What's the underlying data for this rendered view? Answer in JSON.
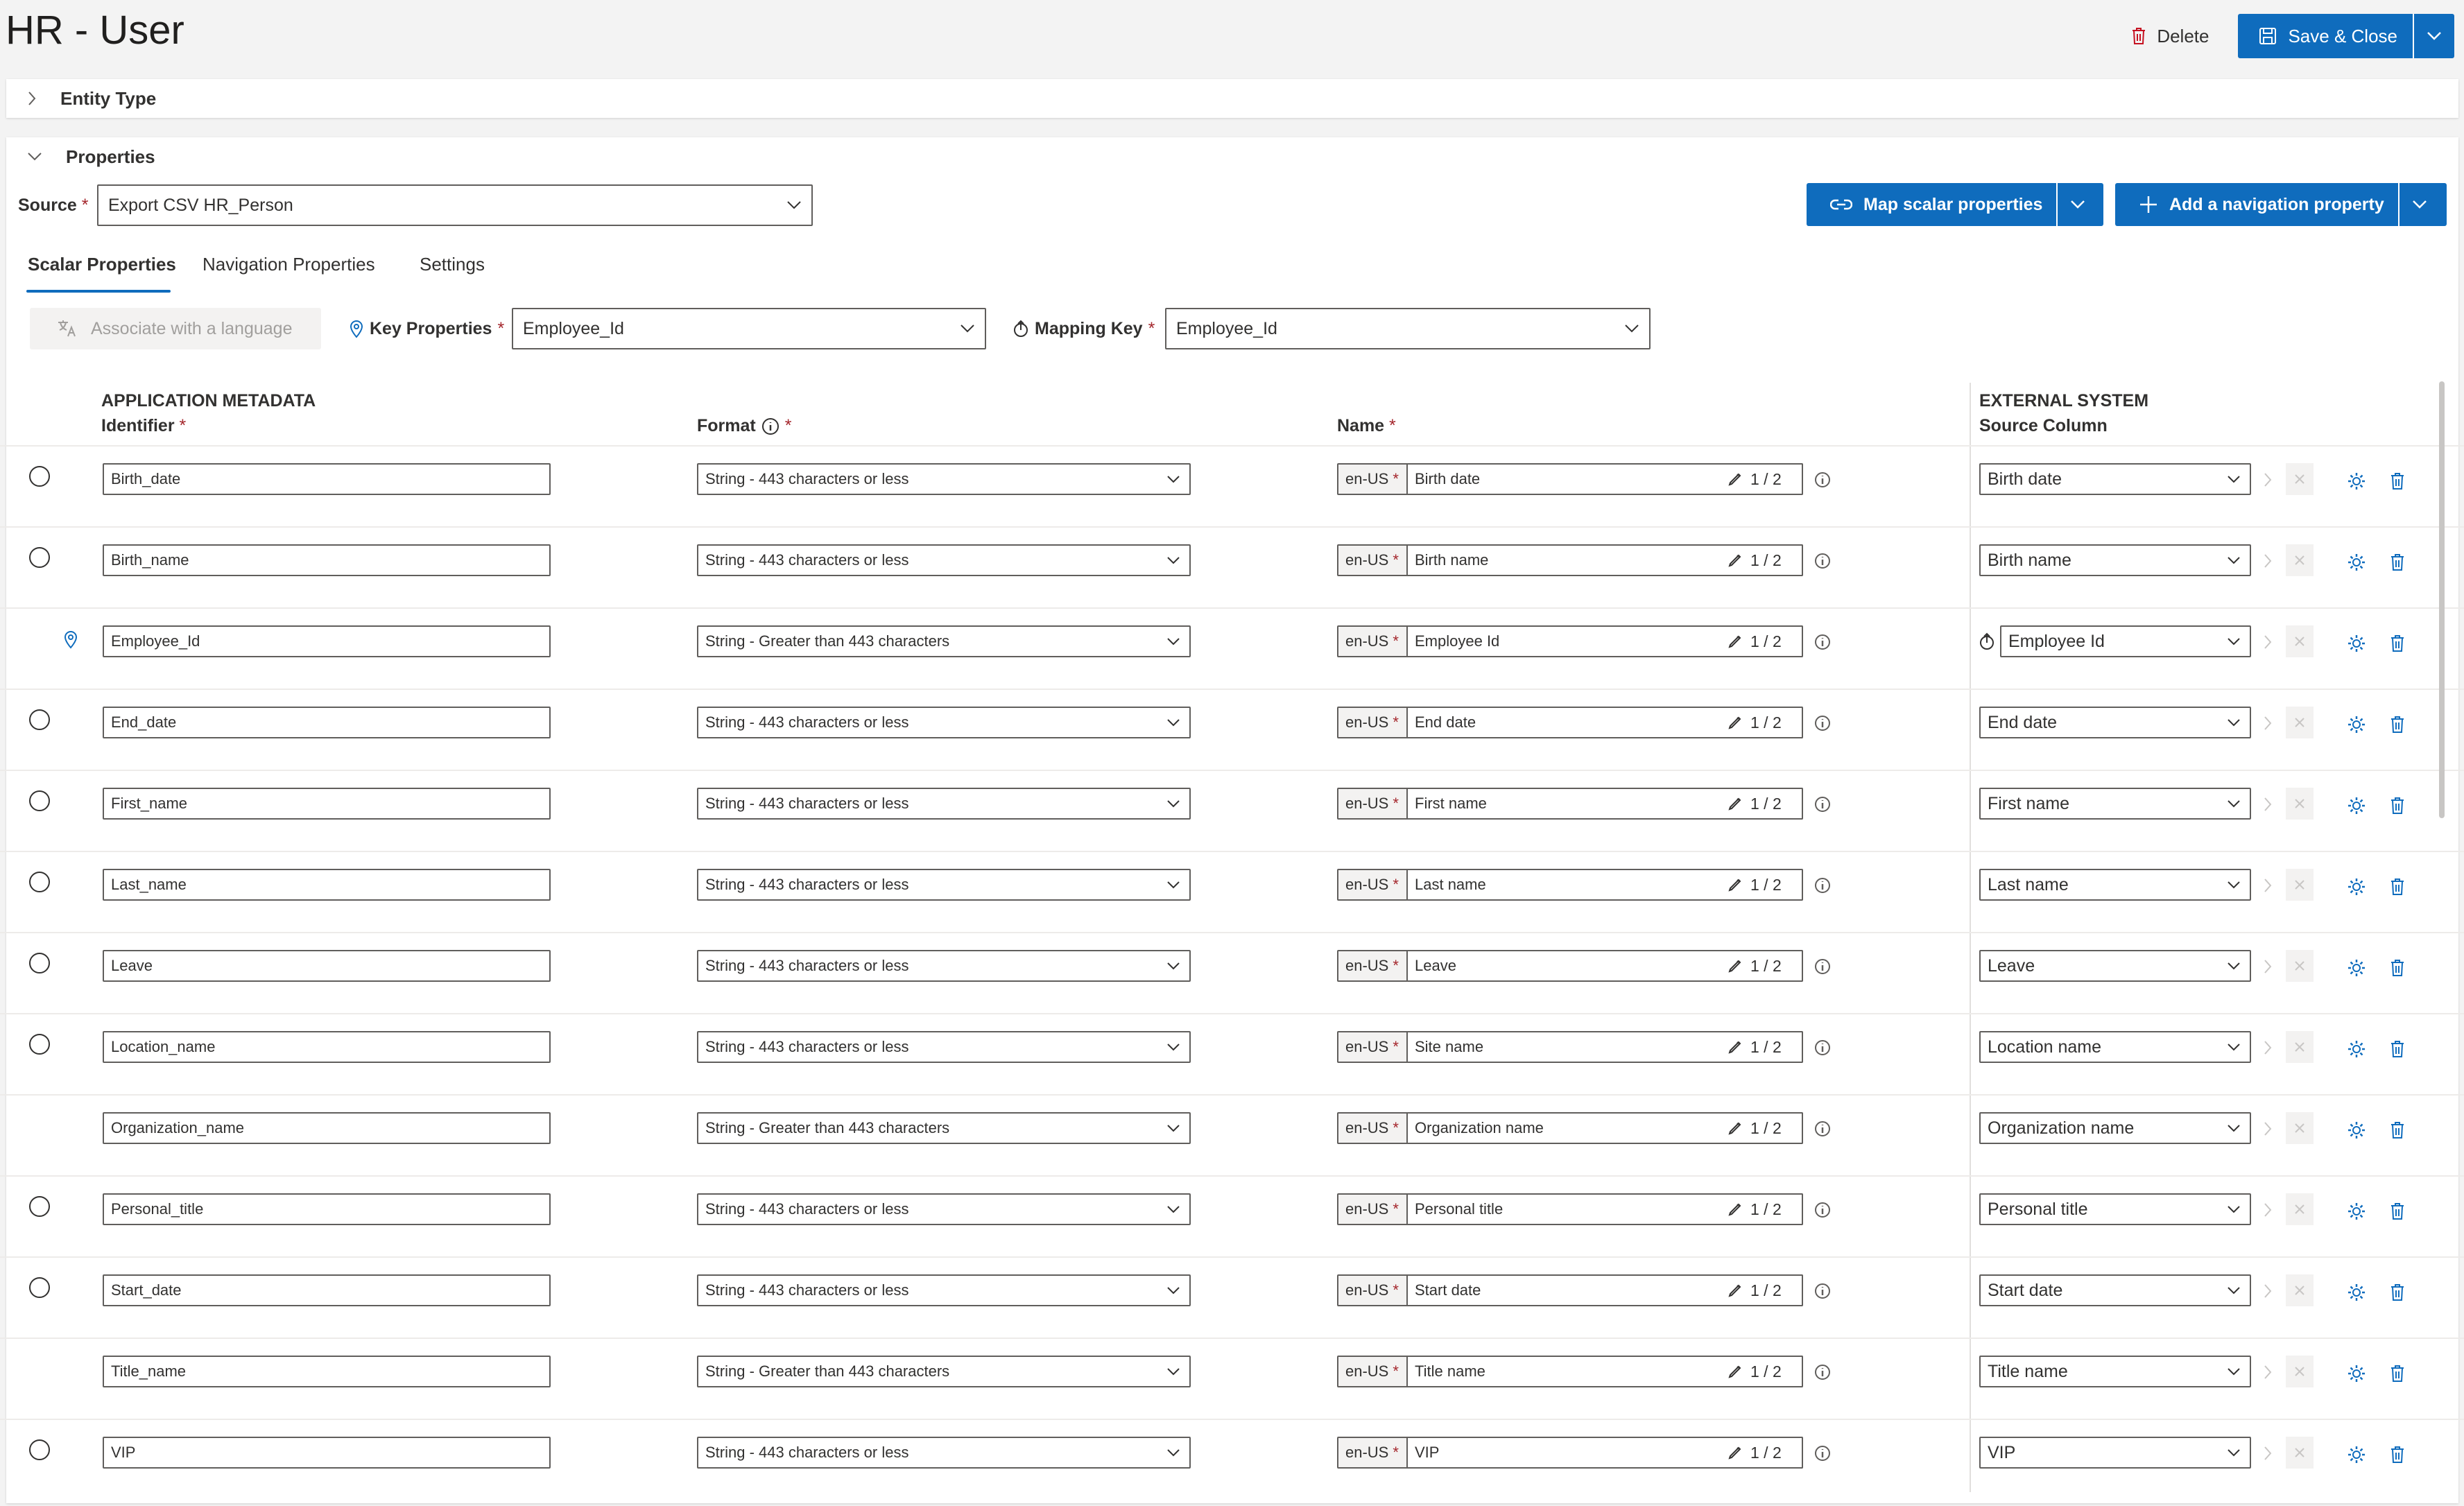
{
  "page": {
    "title": "HR - User"
  },
  "top_actions": {
    "delete_label": "Delete",
    "save_label": "Save & Close"
  },
  "entity_type": {
    "label": "Entity Type"
  },
  "properties": {
    "label": "Properties",
    "source_label": "Source",
    "source_value": "Export CSV HR_Person",
    "map_button": "Map scalar properties",
    "add_nav_button": "Add a navigation property"
  },
  "tabs": [
    {
      "label": "Scalar Properties"
    },
    {
      "label": "Navigation Properties"
    },
    {
      "label": "Settings"
    }
  ],
  "toolbar": {
    "associate_label": "Associate with a language",
    "key_label": "Key Properties",
    "key_value": "Employee_Id",
    "mapping_label": "Mapping Key",
    "mapping_value": "Employee_Id"
  },
  "columns": {
    "app_metadata": "APPLICATION METADATA",
    "identifier": "Identifier",
    "format": "Format",
    "name": "Name",
    "external_system": "EXTERNAL SYSTEM",
    "source_column": "Source Column"
  },
  "rows": [
    {
      "identifier": "Birth_date",
      "format": "String - 443 characters or less",
      "lang": "en-US",
      "name": "Birth date",
      "count": "1 / 2",
      "source": "Birth date",
      "marker": "radio"
    },
    {
      "identifier": "Birth_name",
      "format": "String - 443 characters or less",
      "lang": "en-US",
      "name": "Birth name",
      "count": "1 / 2",
      "source": "Birth name",
      "marker": "radio"
    },
    {
      "identifier": "Employee_Id",
      "format": "String - Greater than 443 characters",
      "lang": "en-US",
      "name": "Employee Id",
      "count": "1 / 2",
      "source": "Employee Id",
      "marker": "key"
    },
    {
      "identifier": "End_date",
      "format": "String - 443 characters or less",
      "lang": "en-US",
      "name": "End date",
      "count": "1 / 2",
      "source": "End date",
      "marker": "radio"
    },
    {
      "identifier": "First_name",
      "format": "String - 443 characters or less",
      "lang": "en-US",
      "name": "First name",
      "count": "1 / 2",
      "source": "First name",
      "marker": "radio"
    },
    {
      "identifier": "Last_name",
      "format": "String - 443 characters or less",
      "lang": "en-US",
      "name": "Last name",
      "count": "1 / 2",
      "source": "Last name",
      "marker": "radio"
    },
    {
      "identifier": "Leave",
      "format": "String - 443 characters or less",
      "lang": "en-US",
      "name": "Leave",
      "count": "1 / 2",
      "source": "Leave",
      "marker": "radio"
    },
    {
      "identifier": "Location_name",
      "format": "String - 443 characters or less",
      "lang": "en-US",
      "name": "Site name",
      "count": "1 / 2",
      "source": "Location name",
      "marker": "radio"
    },
    {
      "identifier": "Organization_name",
      "format": "String - Greater than 443 characters",
      "lang": "en-US",
      "name": "Organization name",
      "count": "1 / 2",
      "source": "Organization name",
      "marker": "none"
    },
    {
      "identifier": "Personal_title",
      "format": "String - 443 characters or less",
      "lang": "en-US",
      "name": "Personal title",
      "count": "1 / 2",
      "source": "Personal title",
      "marker": "radio"
    },
    {
      "identifier": "Start_date",
      "format": "String - 443 characters or less",
      "lang": "en-US",
      "name": "Start date",
      "count": "1 / 2",
      "source": "Start date",
      "marker": "radio"
    },
    {
      "identifier": "Title_name",
      "format": "String - Greater than 443 characters",
      "lang": "en-US",
      "name": "Title name",
      "count": "1 / 2",
      "source": "Title name",
      "marker": "none"
    },
    {
      "identifier": "VIP",
      "format": "String - 443 characters or less",
      "lang": "en-US",
      "name": "VIP",
      "count": "1 / 2",
      "source": "VIP",
      "marker": "radio"
    }
  ],
  "colors": {
    "accent": "#0f6cbd",
    "required": "#a4262c",
    "delete_icon": "#c50f1f"
  }
}
